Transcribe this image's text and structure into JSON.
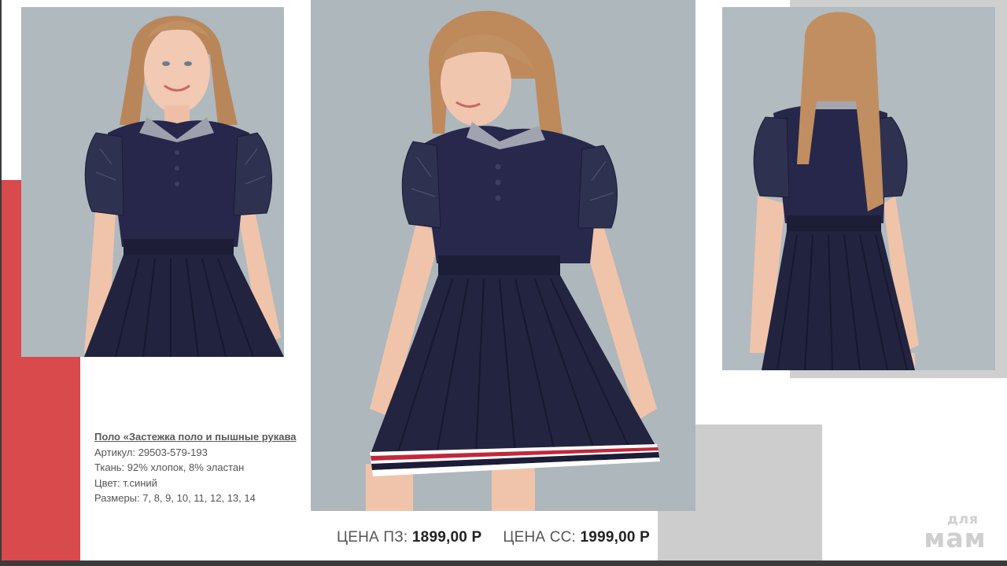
{
  "product": {
    "title": "Поло «Застежка поло и пышные рукава",
    "article": "Артикул: 29503-579-193",
    "fabric": "Ткань: 92% хлопок, 8% эластан",
    "color": "Цвет: т.синий",
    "sizes": "Размеры: 7, 8, 9, 10, 11, 12, 13, 14"
  },
  "prices": {
    "pz_label": "ЦЕНА ПЗ:",
    "pz_value": "1899,00 Р",
    "ss_label": "ЦЕНА СС:",
    "ss_value": "1999,00 Р"
  },
  "logo": {
    "top": "для",
    "bottom": "мам"
  },
  "photos": [
    {
      "name": "photo-front",
      "view": "front"
    },
    {
      "name": "photo-side",
      "view": "three-quarter"
    },
    {
      "name": "photo-back",
      "view": "back"
    }
  ],
  "colors": {
    "accent_red": "#d94a4c",
    "gray_block": "#cfcfcf",
    "navy_garment": "#23233f",
    "photo_bg": "#aeb7bc"
  }
}
